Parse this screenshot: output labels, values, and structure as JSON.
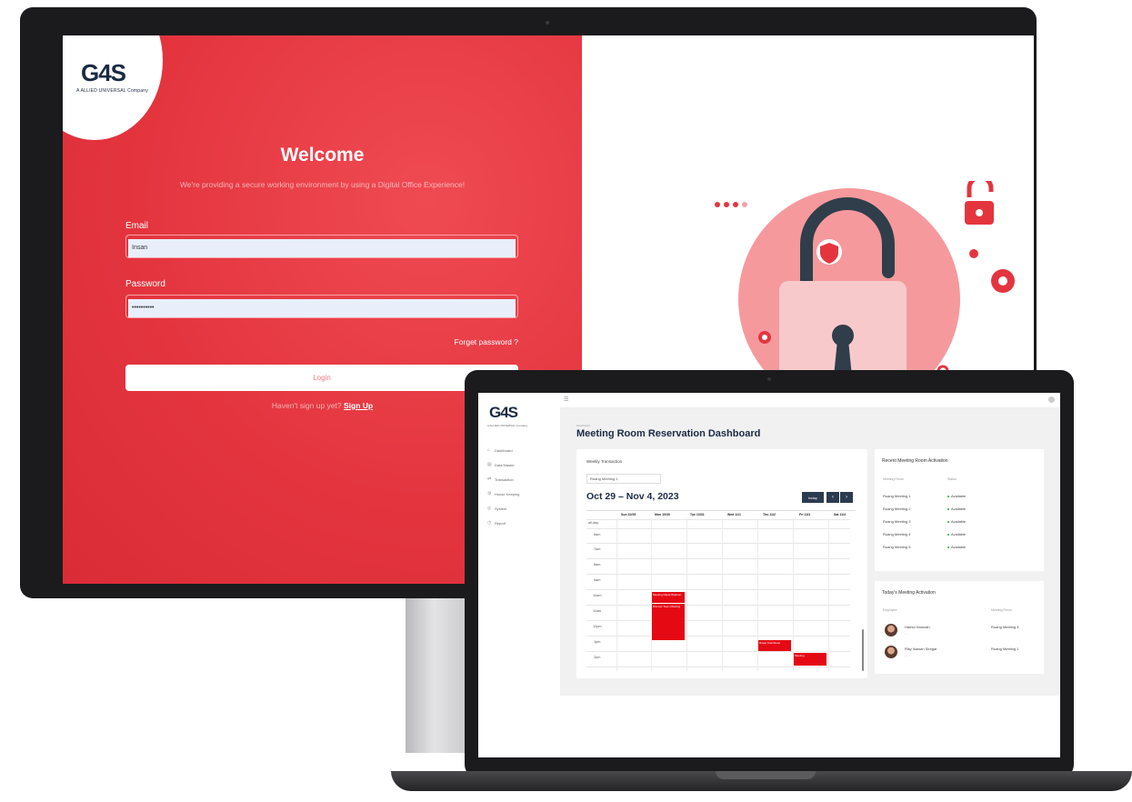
{
  "login": {
    "logo_text": "G4S",
    "logo_subtitle": "A ALLIED UNIVERSAL Company",
    "title": "Welcome",
    "subtitle": "We're providing a secure working environment by using a Digital Office Experience!",
    "email_label": "Email",
    "email_value": "Insan",
    "password_label": "Password",
    "password_value": "••••••••••",
    "forgot_label": "Forget password ?",
    "login_label": "Login",
    "signup_prompt": "Haven't sign up yet?",
    "signup_link": "Sign Up"
  },
  "dashboard": {
    "logo_text": "G4S",
    "logo_subtitle": "A ALLIED UNIVERSAL Company",
    "nav": [
      {
        "icon": "home-icon",
        "label": "Dashboard"
      },
      {
        "icon": "database-icon",
        "label": "Data Master"
      },
      {
        "icon": "swap-icon",
        "label": "Transaction"
      },
      {
        "icon": "gear-icon",
        "label": "House Keeping"
      },
      {
        "icon": "system-icon",
        "label": "System"
      },
      {
        "icon": "report-icon",
        "label": "Report"
      }
    ],
    "breadcrumb": "Dashboard",
    "page_title": "Meeting Room Reservation Dashboard",
    "calendar": {
      "caption": "Weekly Transaction",
      "room_select": "Ruang Meeting 1",
      "range": "Oct 29 – Nov 4, 2023",
      "today_label": "today",
      "prev_label": "‹",
      "next_label": "›",
      "days": [
        "Sun 10/29",
        "Mon 10/30",
        "Tue 10/31",
        "Wed 11/1",
        "Thu 11/2",
        "Fri 11/3",
        "Sat 11/4"
      ],
      "rows": [
        "all-day",
        "6am",
        "7am",
        "8am",
        "9am",
        "10am",
        "11am",
        "12pm",
        "1pm",
        "2pm"
      ],
      "events": [
        {
          "day": 1,
          "label": "Meeting Rapat Bulanan"
        },
        {
          "day": 1,
          "label": "Discuss Team Meeting"
        },
        {
          "day": 4,
          "label": "Rapat Koordinasi"
        },
        {
          "day": 5,
          "label": "Meeting"
        }
      ]
    },
    "recent": {
      "title": "Recent Meeting Room Activation",
      "col_room": "Meeting Room",
      "col_status": "Status",
      "rows": [
        {
          "room": "Ruang Meeting 1",
          "status": "Available"
        },
        {
          "room": "Ruang Meeting 2",
          "status": "Available"
        },
        {
          "room": "Ruang Meeting 3",
          "status": "Available"
        },
        {
          "room": "Ruang Meeting 4",
          "status": "Available"
        },
        {
          "room": "Ruang Meeting 5",
          "status": "Available"
        }
      ]
    },
    "today": {
      "title": "Today's Meeting Activation",
      "col_employee": "Employee",
      "col_room": "Meeting Room",
      "rows": [
        {
          "name": "Hamid Hamzah",
          "room": "Ruang Meeting 4"
        },
        {
          "name": "Riky Ikawan Siregar",
          "room": "Ruang Meeting 1"
        }
      ]
    }
  },
  "colors": {
    "brand_red": "#e4353f",
    "navy": "#1a2a44",
    "event_red": "#e50914"
  }
}
